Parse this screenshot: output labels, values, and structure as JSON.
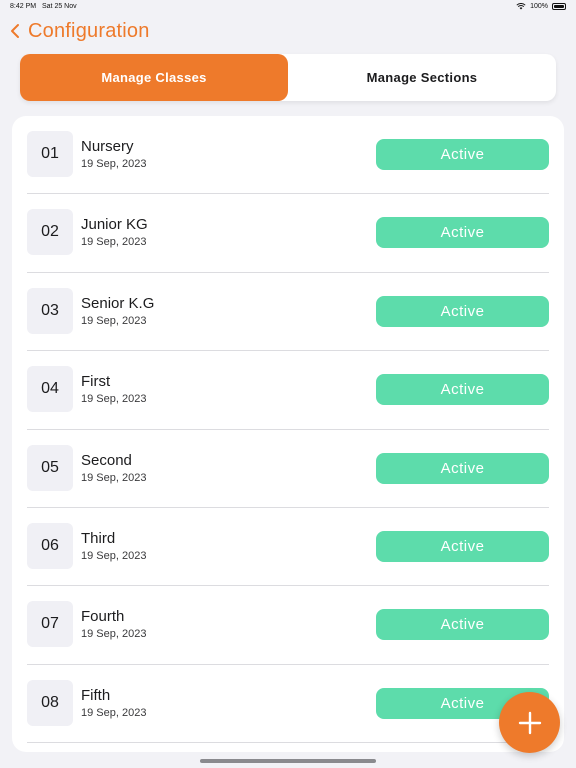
{
  "status_bar": {
    "time": "8:42 PM",
    "date": "Sat 25 Nov",
    "battery": "100%"
  },
  "nav": {
    "title": "Configuration"
  },
  "tabs": [
    {
      "label": "Manage Classes",
      "active": true
    },
    {
      "label": "Manage Sections",
      "active": false
    }
  ],
  "classes": [
    {
      "num": "01",
      "name": "Nursery",
      "date": "19 Sep, 2023",
      "status": "Active"
    },
    {
      "num": "02",
      "name": "Junior KG",
      "date": "19 Sep, 2023",
      "status": "Active"
    },
    {
      "num": "03",
      "name": "Senior K.G",
      "date": "19 Sep, 2023",
      "status": "Active"
    },
    {
      "num": "04",
      "name": "First",
      "date": "19 Sep, 2023",
      "status": "Active"
    },
    {
      "num": "05",
      "name": "Second",
      "date": "19 Sep, 2023",
      "status": "Active"
    },
    {
      "num": "06",
      "name": "Third",
      "date": "19 Sep, 2023",
      "status": "Active"
    },
    {
      "num": "07",
      "name": "Fourth",
      "date": "19 Sep, 2023",
      "status": "Active"
    },
    {
      "num": "08",
      "name": "Fifth",
      "date": "19 Sep, 2023",
      "status": "Active"
    }
  ],
  "colors": {
    "accent": "#ee7a2b",
    "active_status": "#5ddcab"
  },
  "icons": {
    "back": "chevron-left-icon",
    "add": "plus-icon"
  }
}
